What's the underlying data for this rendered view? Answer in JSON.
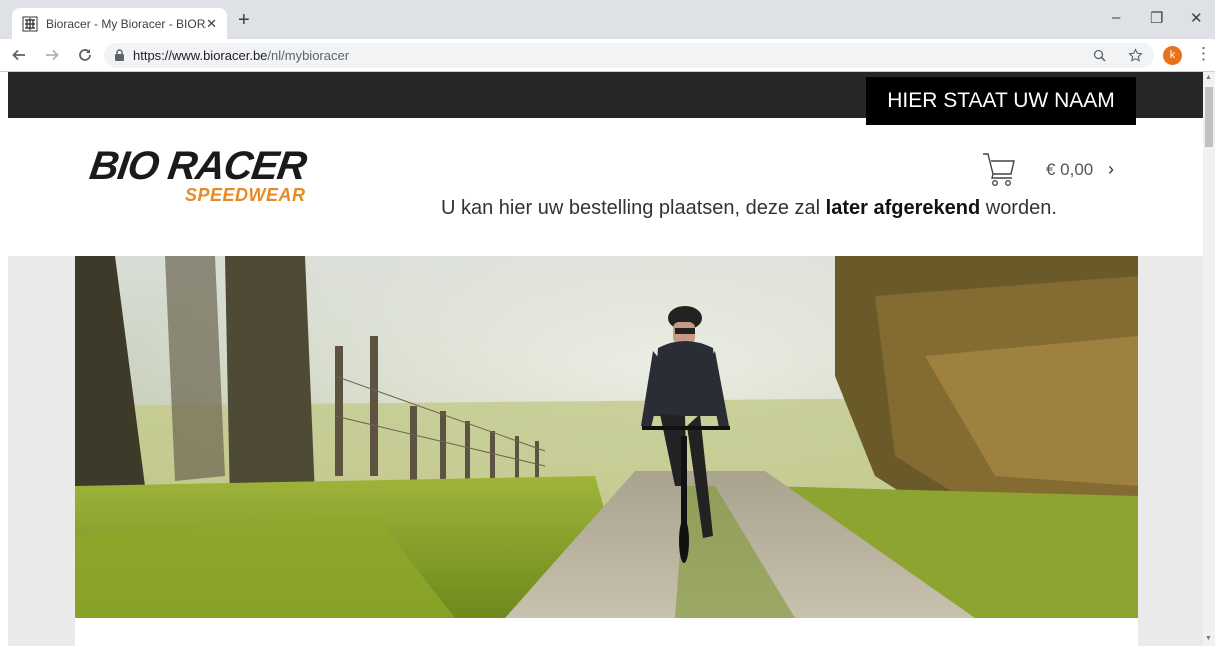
{
  "browser": {
    "tab_title": "Bioracer - My Bioracer - BIORACER",
    "tab_close": "✕",
    "new_tab": "+",
    "url_host": "https://www.bioracer.be",
    "url_path": "/nl/mybioracer",
    "avatar_letter": "k",
    "window_controls": [
      "–",
      "❐",
      "✕"
    ]
  },
  "site": {
    "name_box": "HIER STAAT UW NAAM",
    "logo_main": "BIO RACER",
    "logo_sub": "SPEEDWEAR",
    "cart_total": "€ 0,00",
    "cart_chevron": "›",
    "tagline_before": "U kan hier uw bestelling plaatsen, deze zal ",
    "tagline_bold": "later afgerekend",
    "tagline_after": " worden."
  },
  "colors": {
    "topbar": "#272629",
    "accent_orange": "#e88a24",
    "avatar": "#e8711c"
  },
  "icons": [
    "favicon-bioracer-icon",
    "back-arrow-icon",
    "forward-arrow-icon",
    "reload-icon",
    "lock-icon",
    "zoom-icon",
    "bookmark-star-icon",
    "menu-kebab-icon",
    "shopping-cart-icon"
  ]
}
